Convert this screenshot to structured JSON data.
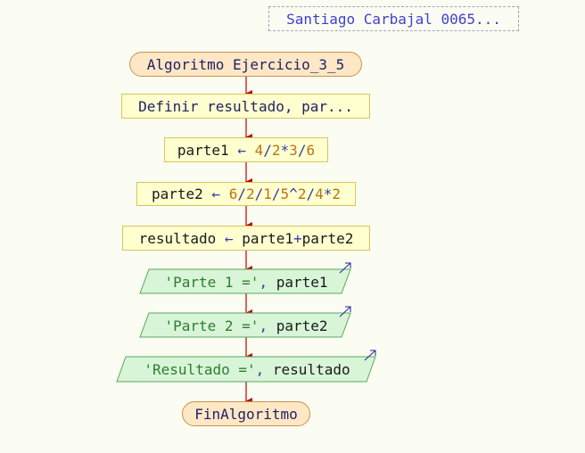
{
  "comment": {
    "text": "Santiago Carbajal 0065..."
  },
  "nodes": {
    "start": {
      "text": "Algoritmo Ejercicio_3_5"
    },
    "define": {
      "text": "Definir resultado, par..."
    },
    "assign1": {
      "var": "parte1",
      "arrow": "←",
      "expr_tokens": [
        "4",
        "/",
        "2",
        "*",
        "3",
        "/",
        "6"
      ]
    },
    "assign2": {
      "var": "parte2",
      "arrow": "←",
      "expr_tokens": [
        "6",
        "/",
        "2",
        "/",
        "1",
        "/",
        "5",
        "^",
        "2",
        "/",
        "4",
        "*",
        "2"
      ]
    },
    "assign3": {
      "var": "resultado",
      "arrow": "←",
      "expr_tokens": [
        "parte1",
        "+",
        "parte2"
      ]
    },
    "output1": {
      "string": "'Parte 1 ='",
      "sep": ",",
      "var": "parte1"
    },
    "output2": {
      "string": "'Parte 2 ='",
      "sep": ",",
      "var": "parte2"
    },
    "output3": {
      "string": "'Resultado ='",
      "sep": ",",
      "var": "resultado"
    },
    "end": {
      "text": "FinAlgoritmo"
    }
  },
  "colors": {
    "arrow": "#c00000",
    "terminal_fill": "#fde7c5",
    "process_fill": "#ffffcf",
    "io_fill": "#d8f5d8",
    "comment_text": "#4040d0",
    "output_arrow": "#2020a0"
  }
}
